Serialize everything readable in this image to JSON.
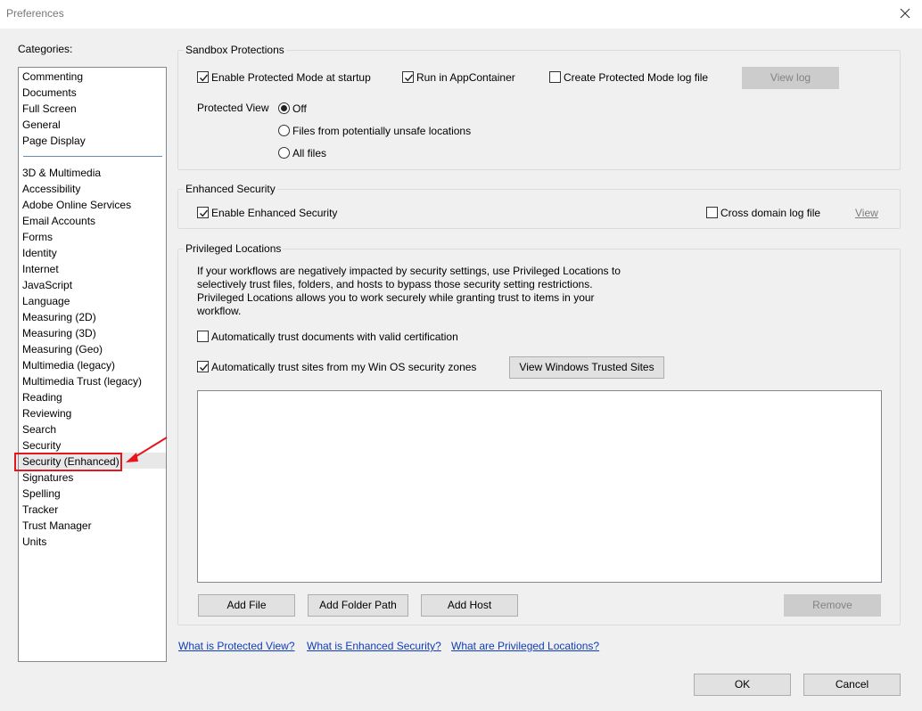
{
  "window": {
    "title": "Preferences",
    "close_icon": "close-icon"
  },
  "categories": {
    "label": "Categories:",
    "top_items": [
      "Commenting",
      "Documents",
      "Full Screen",
      "General",
      "Page Display"
    ],
    "items": [
      "3D & Multimedia",
      "Accessibility",
      "Adobe Online Services",
      "Email Accounts",
      "Forms",
      "Identity",
      "Internet",
      "JavaScript",
      "Language",
      "Measuring (2D)",
      "Measuring (3D)",
      "Measuring (Geo)",
      "Multimedia (legacy)",
      "Multimedia Trust (legacy)",
      "Reading",
      "Reviewing",
      "Search",
      "Security",
      "Security (Enhanced)",
      "Signatures",
      "Spelling",
      "Tracker",
      "Trust Manager",
      "Units"
    ],
    "selected": "Security (Enhanced)"
  },
  "sandbox": {
    "title": "Sandbox Protections",
    "protected_mode": {
      "label": "Enable Protected Mode at startup",
      "checked": true
    },
    "app_container": {
      "label": "Run in AppContainer",
      "checked": true
    },
    "log_file": {
      "label": "Create Protected Mode log file",
      "checked": false
    },
    "view_log": "View log",
    "protected_view_label": "Protected View",
    "protected_view_options": [
      "Off",
      "Files from potentially unsafe locations",
      "All files"
    ],
    "protected_view_selected": "Off"
  },
  "enhanced": {
    "title": "Enhanced Security",
    "enable": {
      "label": "Enable Enhanced Security",
      "checked": true
    },
    "cross_domain": {
      "label": "Cross domain log file",
      "checked": false
    },
    "view_link": "View"
  },
  "privileged": {
    "title": "Privileged Locations",
    "description_lines": [
      "If your workflows are negatively impacted by security settings, use Privileged Locations to",
      "selectively trust files, folders, and hosts to bypass those security setting restrictions.",
      "Privileged Locations allows you to work securely while granting trust to items in your",
      "workflow."
    ],
    "trust_certified": {
      "label": "Automatically trust documents with valid certification",
      "checked": false
    },
    "trust_sites": {
      "label": "Automatically trust sites from my Win OS security zones",
      "checked": true
    },
    "view_trusted_sites": "View Windows Trusted Sites",
    "locations": [],
    "add_file": "Add File",
    "add_folder": "Add Folder Path",
    "add_host": "Add Host",
    "remove": "Remove"
  },
  "help_links": {
    "protected_view": "What is Protected View?",
    "enhanced_security": "What is Enhanced Security?",
    "privileged_locations": "What are Privileged Locations?"
  },
  "footer": {
    "ok": "OK",
    "cancel": "Cancel"
  },
  "colors": {
    "highlight_box": "#e8141c",
    "link": "#0f3dba"
  }
}
